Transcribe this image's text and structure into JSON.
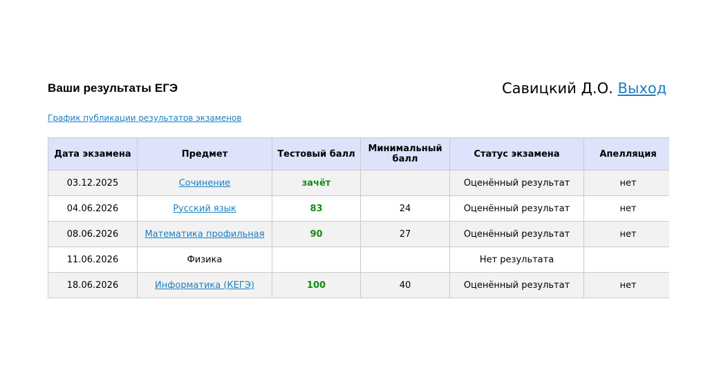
{
  "header": {
    "title": "Ваши результаты ЕГЭ",
    "user_name": "Савицкий Д.О.",
    "logout_label": "Выход"
  },
  "schedule_link": "График публикации результатов экзаменов",
  "table": {
    "columns": [
      "Дата экзамена",
      "Предмет",
      "Тестовый балл",
      "Минимальный балл",
      "Статус экзамена",
      "Апелляция"
    ],
    "rows": [
      {
        "date": "03.12.2025",
        "subject": "Сочинение",
        "subject_link": true,
        "score": "зачёт",
        "min_score": "",
        "status": "Оценённый результат",
        "appeal": "нет"
      },
      {
        "date": "04.06.2026",
        "subject": "Русский язык",
        "subject_link": true,
        "score": "83",
        "min_score": "24",
        "status": "Оценённый результат",
        "appeal": "нет"
      },
      {
        "date": "08.06.2026",
        "subject": "Математика профильная",
        "subject_link": true,
        "score": "90",
        "min_score": "27",
        "status": "Оценённый результат",
        "appeal": "нет"
      },
      {
        "date": "11.06.2026",
        "subject": "Физика",
        "subject_link": false,
        "score": "",
        "min_score": "",
        "status": "Нет результата",
        "appeal": ""
      },
      {
        "date": "18.06.2026",
        "subject": "Информатика (КЕГЭ)",
        "subject_link": true,
        "score": "100",
        "min_score": "40",
        "status": "Оценённый результат",
        "appeal": "нет"
      }
    ]
  },
  "colors": {
    "link": "#1a7fc4",
    "score": "#148c14",
    "header_bg": "#dde3fb",
    "row_alt_bg": "#f2f2f2",
    "border": "#c9c9c9"
  }
}
